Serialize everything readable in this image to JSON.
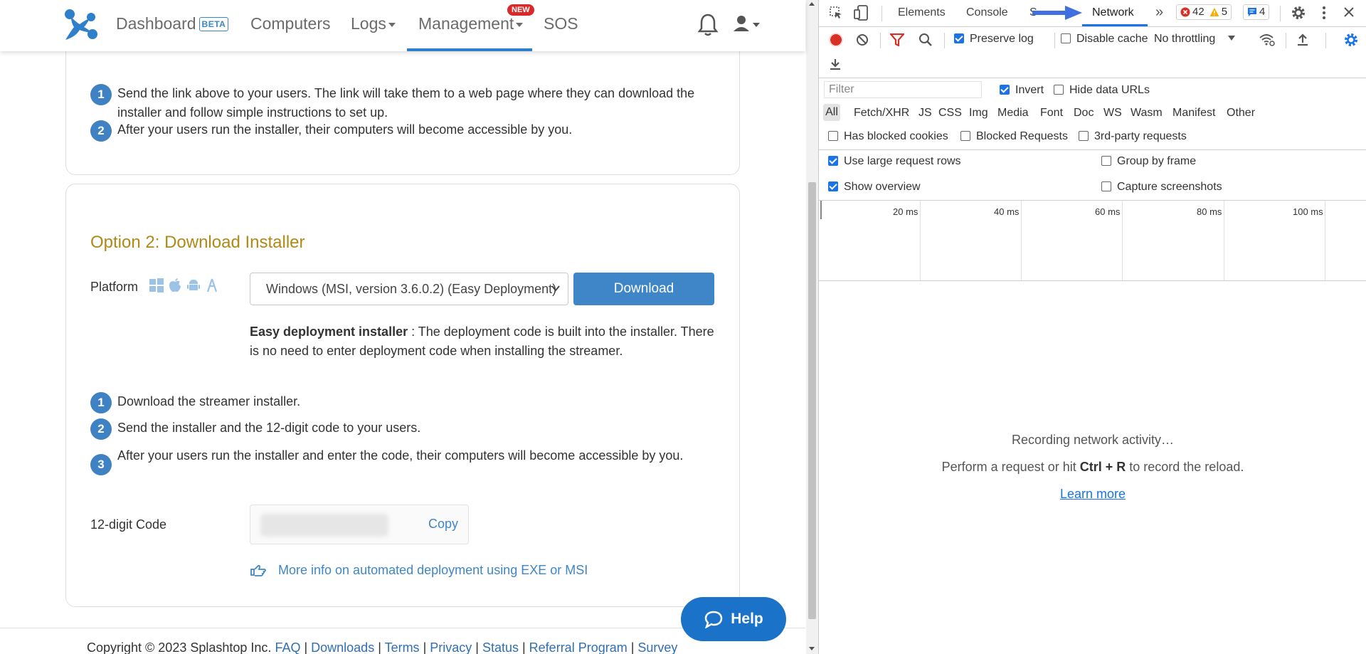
{
  "nav": {
    "dashboard": "Dashboard",
    "beta": "BETA",
    "computers": "Computers",
    "logs": "Logs",
    "management": "Management",
    "new_badge": "NEW",
    "sos": "SOS"
  },
  "option1": {
    "steps": [
      {
        "num": "1",
        "text": "Send the link above to your users. The link will take them to a web page where they can download the installer and follow simple instructions to set up."
      },
      {
        "num": "2",
        "text": "After your users run the installer, their computers will become accessible by you."
      }
    ]
  },
  "option2": {
    "title": "Option 2: Download Installer",
    "platform_label": "Platform",
    "select_value": "Windows (MSI, version 3.6.0.2) (Easy Deployment)",
    "download_label": "Download",
    "easy_bold": "Easy deployment installer",
    "easy_text": " : The deployment code is built into the installer. There is no need to enter deployment code when installing the streamer.",
    "steps": [
      {
        "num": "1",
        "text": "Download the streamer installer."
      },
      {
        "num": "2",
        "text": "Send the installer and the 12-digit code to your users."
      },
      {
        "num": "3",
        "text": "After your users run the installer and enter the code, their computers will become accessible by you."
      }
    ],
    "code_label": "12-digit Code",
    "copy_label": "Copy",
    "more_info": "More info on automated deployment using EXE or MSI"
  },
  "footer": {
    "copyright": "Copyright © 2023 Splashtop Inc.",
    "links": [
      "FAQ",
      "Downloads",
      "Terms",
      "Privacy",
      "Status",
      "Referral Program",
      "Survey"
    ]
  },
  "help_label": "Help",
  "devtools": {
    "tabs": {
      "elements": "Elements",
      "console": "Console",
      "sources": "S",
      "network": "Network"
    },
    "errors": "42",
    "warnings": "5",
    "messages": "4",
    "preserve_log": "Preserve log",
    "disable_cache": "Disable cache",
    "throttling": "No throttling",
    "filter_placeholder": "Filter",
    "invert": "Invert",
    "hide_data_urls": "Hide data URLs",
    "types": [
      "All",
      "Fetch/XHR",
      "JS",
      "CSS",
      "Img",
      "Media",
      "Font",
      "Doc",
      "WS",
      "Wasm",
      "Manifest",
      "Other"
    ],
    "has_blocked_cookies": "Has blocked cookies",
    "blocked_requests": "Blocked Requests",
    "third_party": "3rd-party requests",
    "large_rows": "Use large request rows",
    "group_by_frame": "Group by frame",
    "show_overview": "Show overview",
    "capture_screenshots": "Capture screenshots",
    "timeline_labels": [
      "20 ms",
      "40 ms",
      "60 ms",
      "80 ms",
      "100 ms"
    ],
    "recording": "Recording network activity…",
    "perform_pre": "Perform a request or hit ",
    "perform_key": "Ctrl + R",
    "perform_post": " to record the reload.",
    "learn_more": "Learn more"
  },
  "colors": {
    "brand_blue": "#3f82c4",
    "option_title": "#b08a17",
    "devtools_accent": "#1a73e8",
    "error_red": "#d93025",
    "warning_yellow": "#f9ab00"
  }
}
